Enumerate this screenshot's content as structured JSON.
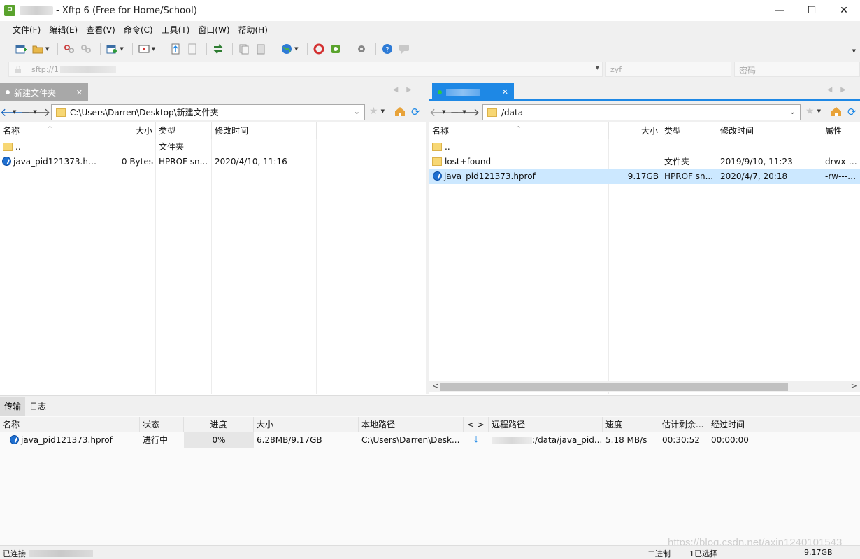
{
  "window": {
    "title": "- Xftp 6 (Free for Home/School)",
    "minimize": "—",
    "maximize": "☐",
    "close": "✕"
  },
  "menu": [
    "文件(F)",
    "编辑(E)",
    "查看(V)",
    "命令(C)",
    "工具(T)",
    "窗口(W)",
    "帮助(H)"
  ],
  "address": {
    "prefix": "sftp://1",
    "user": "zyf",
    "password_placeholder": "密码"
  },
  "left_pane": {
    "tab_label": "新建文件夹",
    "path": "C:\\Users\\Darren\\Desktop\\新建文件夹",
    "columns": [
      "名称",
      "大小",
      "类型",
      "修改时间"
    ],
    "rows": [
      {
        "name": "..",
        "size": "",
        "type": "文件夹",
        "modified": ""
      },
      {
        "name": "java_pid121373.hprof",
        "size": "0 Bytes",
        "type": "HPROF sn...",
        "modified": "2020/4/10, 11:16"
      }
    ]
  },
  "right_pane": {
    "path": "/data",
    "columns": [
      "名称",
      "大小",
      "类型",
      "修改时间",
      "属性"
    ],
    "rows": [
      {
        "name": "..",
        "size": "",
        "type": "",
        "modified": "",
        "attrs": ""
      },
      {
        "name": "lost+found",
        "size": "",
        "type": "文件夹",
        "modified": "2019/9/10, 11:23",
        "attrs": "drwx------"
      },
      {
        "name": "java_pid121373.hprof",
        "size": "9.17GB",
        "type": "HPROF sn...",
        "modified": "2020/4/7, 20:18",
        "attrs": "-rw-------"
      }
    ]
  },
  "bottom": {
    "tabs": [
      "传输",
      "日志"
    ],
    "columns": [
      "名称",
      "状态",
      "进度",
      "大小",
      "本地路径",
      "<->",
      "远程路径",
      "速度",
      "估计剩余...",
      "经过时间"
    ],
    "transfer": {
      "name": "java_pid121373.hprof",
      "status": "进行中",
      "progress": "0%",
      "progress_value": 0,
      "size": "6.28MB/9.17GB",
      "local_path": "C:\\Users\\Darren\\Desk...",
      "remote_path": ":/data/java_pid...",
      "speed": "5.18 MB/s",
      "eta": "00:30:52",
      "elapsed": "00:00:00"
    }
  },
  "status": {
    "connected": "已连接",
    "mode": "二进制",
    "selected": "1已选择",
    "size": "9.17GB"
  },
  "watermark": "https://blog.csdn.net/axin1240101543",
  "colors": {
    "accent": "#1e88e5",
    "selection": "#cce8ff",
    "inactive_tab": "#a8a8a8"
  }
}
